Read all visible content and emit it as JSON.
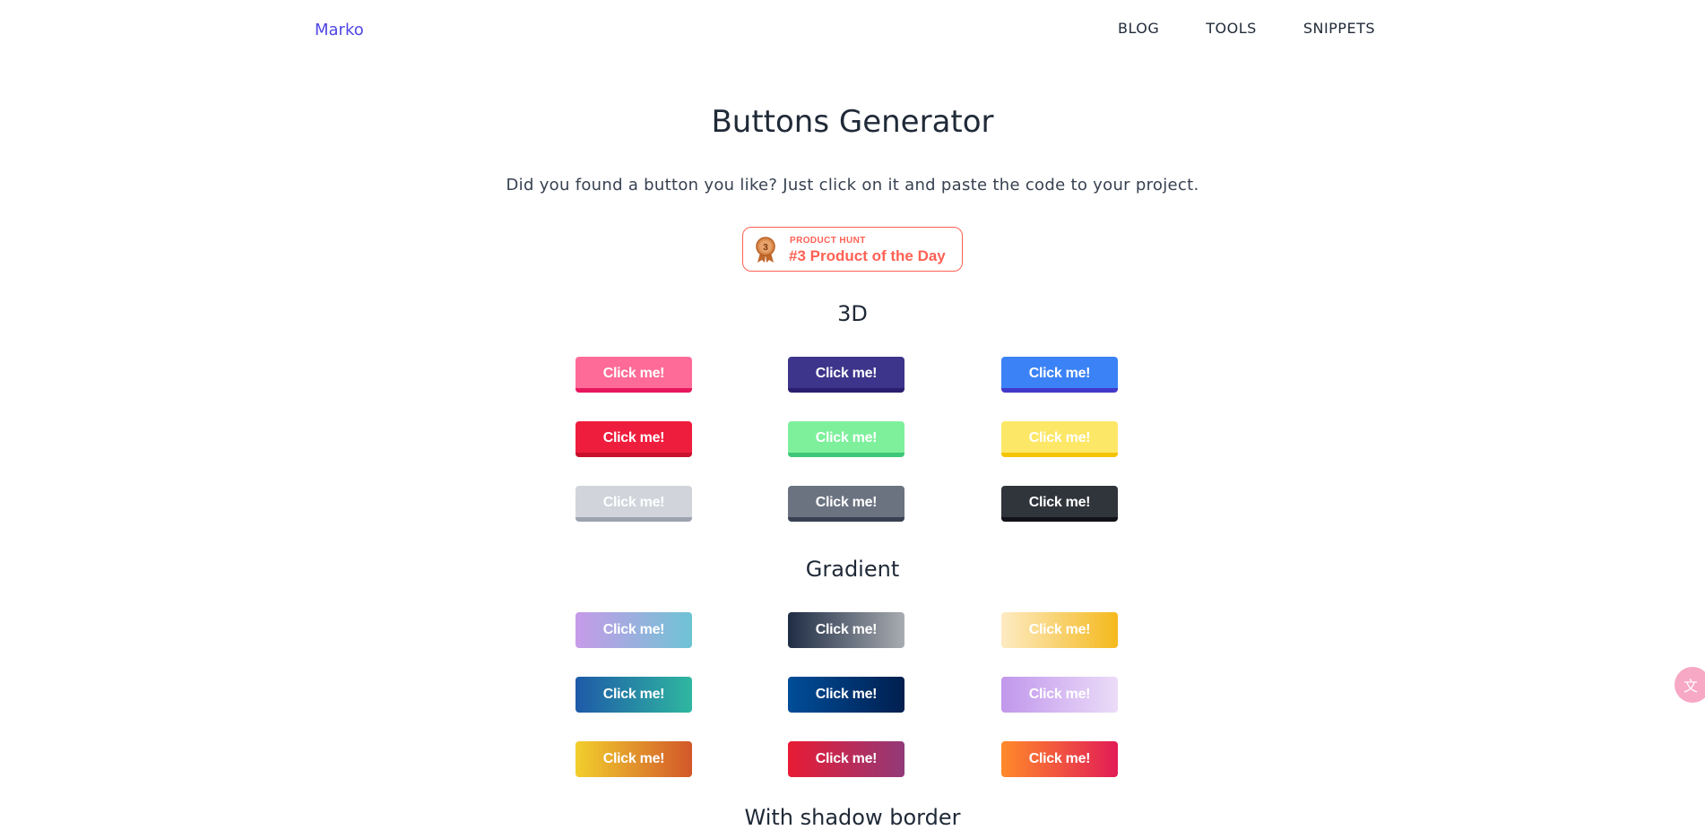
{
  "nav": {
    "logo": "Marko",
    "links": [
      "BLOG",
      "TOOLS",
      "SNIPPETS"
    ]
  },
  "header": {
    "title": "Buttons Generator",
    "subtitle": "Did you found a button you like? Just click on it and paste the code to your project."
  },
  "badge": {
    "small": "PRODUCT HUNT",
    "big": "#3 Product of the Day",
    "medal_number": "3",
    "color": "#ff6154"
  },
  "sections": [
    {
      "title": "3D",
      "buttons": [
        {
          "label": "Click me!",
          "bg": "#ff6b98",
          "edge": "#e8175d"
        },
        {
          "label": "Click me!",
          "bg": "#3d348b",
          "edge": "#2a1f6e"
        },
        {
          "label": "Click me!",
          "bg": "#3b82f6",
          "edge": "#4338ca"
        },
        {
          "label": "Click me!",
          "bg": "#ef1d3d",
          "edge": "#c9102c"
        },
        {
          "label": "Click me!",
          "bg": "#7ef09c",
          "edge": "#3fc779"
        },
        {
          "label": "Click me!",
          "bg": "#fde767",
          "edge": "#f5c400"
        },
        {
          "label": "Click me!",
          "bg": "#d1d5db",
          "edge": "#9ca3af"
        },
        {
          "label": "Click me!",
          "bg": "#6b7280",
          "edge": "#374151"
        },
        {
          "label": "Click me!",
          "bg": "#30343b",
          "edge": "#111318"
        }
      ]
    },
    {
      "title": "Gradient",
      "buttons": [
        {
          "label": "Click me!",
          "from": "#c79be8",
          "to": "#6ec3d4"
        },
        {
          "label": "Click me!",
          "from": "#1f2d45",
          "to": "#a8acb1"
        },
        {
          "label": "Click me!",
          "from": "#fdebc3",
          "to": "#f4b91c"
        },
        {
          "label": "Click me!",
          "from": "#1e5aa8",
          "to": "#2fb7a0"
        },
        {
          "label": "Click me!",
          "from": "#004d99",
          "to": "#011f4f"
        },
        {
          "label": "Click me!",
          "from": "#c197ec",
          "to": "#ebdcf8"
        },
        {
          "label": "Click me!",
          "from": "#f2cf2d",
          "to": "#d2572a"
        },
        {
          "label": "Click me!",
          "from": "#e81b35",
          "to": "#923a78"
        },
        {
          "label": "Click me!",
          "from": "#ff8a2a",
          "to": "#e21c56"
        }
      ]
    }
  ],
  "next_section_title": "With shadow border",
  "side_widget": {
    "icon": "translate-icon"
  }
}
